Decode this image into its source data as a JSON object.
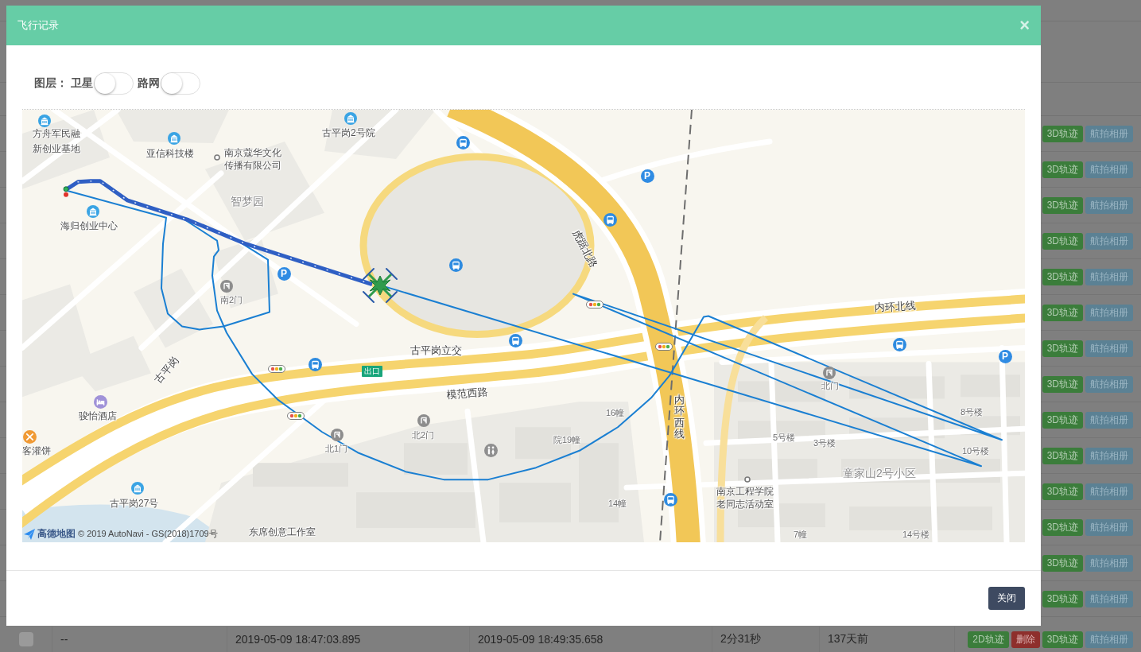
{
  "page": {
    "table": {
      "rows": [
        {
          "actions": [
            {
              "label": "3D轨迹",
              "kind": "track"
            },
            {
              "label": "航拍相册",
              "kind": "album"
            }
          ]
        },
        {
          "actions": [
            {
              "label": "3D轨迹",
              "kind": "track"
            },
            {
              "label": "航拍相册",
              "kind": "album"
            }
          ]
        },
        {
          "actions": [
            {
              "label": "3D轨迹",
              "kind": "track"
            },
            {
              "label": "航拍相册",
              "kind": "album"
            }
          ]
        },
        {
          "actions": [
            {
              "label": "3D轨迹",
              "kind": "track"
            },
            {
              "label": "航拍相册",
              "kind": "album"
            }
          ]
        },
        {
          "actions": [
            {
              "label": "3D轨迹",
              "kind": "track"
            },
            {
              "label": "航拍相册",
              "kind": "album"
            }
          ]
        },
        {
          "actions": [
            {
              "label": "3D轨迹",
              "kind": "track"
            },
            {
              "label": "航拍相册",
              "kind": "album"
            }
          ]
        },
        {
          "actions": [
            {
              "label": "3D轨迹",
              "kind": "track"
            },
            {
              "label": "航拍相册",
              "kind": "album"
            }
          ]
        },
        {
          "actions": [
            {
              "label": "3D轨迹",
              "kind": "track"
            },
            {
              "label": "航拍相册",
              "kind": "album"
            }
          ]
        },
        {
          "actions": [
            {
              "label": "3D轨迹",
              "kind": "track"
            },
            {
              "label": "航拍相册",
              "kind": "album"
            }
          ]
        },
        {
          "actions": [
            {
              "label": "3D轨迹",
              "kind": "track"
            },
            {
              "label": "航拍相册",
              "kind": "album"
            }
          ]
        },
        {
          "actions": [
            {
              "label": "3D轨迹",
              "kind": "track"
            },
            {
              "label": "航拍相册",
              "kind": "album"
            }
          ]
        },
        {
          "actions": [
            {
              "label": "3D轨迹",
              "kind": "track"
            },
            {
              "label": "航拍相册",
              "kind": "album"
            }
          ]
        },
        {
          "actions": [
            {
              "label": "3D轨迹",
              "kind": "track"
            },
            {
              "label": "航拍相册",
              "kind": "album"
            }
          ]
        },
        {
          "actions": [
            {
              "label": "3D轨迹",
              "kind": "track"
            },
            {
              "label": "航拍相册",
              "kind": "album"
            }
          ]
        },
        {
          "checked": false,
          "cells": [
            "--",
            "2019-05-09 18:47:03.895",
            "2019-05-09 18:49:35.658",
            "2分31秒",
            "137天前"
          ],
          "actions": [
            {
              "label": "2D轨迹",
              "kind": "track"
            },
            {
              "label": "删除",
              "kind": "delete"
            },
            {
              "label": "3D轨迹",
              "kind": "track"
            },
            {
              "label": "航拍相册",
              "kind": "album"
            }
          ]
        }
      ]
    }
  },
  "dialog": {
    "title": "飞行记录",
    "close": "×",
    "layers": {
      "label": "图层：",
      "toggles": [
        {
          "label": "卫星",
          "on": false
        },
        {
          "label": "路网",
          "on": false
        }
      ]
    },
    "map": {
      "labels": [
        {
          "text": "方舟军民融",
          "kind": "place"
        },
        {
          "text": "新创业基地",
          "kind": "place"
        },
        {
          "text": "亚信科技楼",
          "kind": "place"
        },
        {
          "text": "南京蔻华文化传播有限公司",
          "kind": "place"
        },
        {
          "text": "古平岗2号院",
          "kind": "place"
        },
        {
          "text": "智梦园",
          "kind": "area"
        },
        {
          "text": "海归创业中心",
          "kind": "place"
        },
        {
          "text": "南2门",
          "kind": "minor"
        },
        {
          "text": "古平岗立交",
          "kind": "road"
        },
        {
          "text": "古平岗",
          "kind": "road"
        },
        {
          "text": "模范西路",
          "kind": "road"
        },
        {
          "text": "北2门",
          "kind": "minor"
        },
        {
          "text": "北1门",
          "kind": "minor"
        },
        {
          "text": "骏怡酒店",
          "kind": "place"
        },
        {
          "text": "客灌饼",
          "kind": "place"
        },
        {
          "text": "古平岗27号",
          "kind": "place"
        },
        {
          "text": "东席创意工作室",
          "kind": "place"
        },
        {
          "text": "虎踞北路",
          "kind": "road"
        },
        {
          "text": "内环北线",
          "kind": "road"
        },
        {
          "text": "内环西线",
          "kind": "road"
        },
        {
          "text": "北门",
          "kind": "minor"
        },
        {
          "text": "16幢",
          "kind": "minor"
        },
        {
          "text": "院19幢",
          "kind": "minor"
        },
        {
          "text": "14幢",
          "kind": "minor"
        },
        {
          "text": "5号楼",
          "kind": "minor"
        },
        {
          "text": "3号楼",
          "kind": "minor"
        },
        {
          "text": "8号楼",
          "kind": "minor"
        },
        {
          "text": "10号楼",
          "kind": "minor"
        },
        {
          "text": "童家山2号小区",
          "kind": "area"
        },
        {
          "text": "南京工程学院老同志活动室",
          "kind": "place"
        },
        {
          "text": "7幢",
          "kind": "minor"
        },
        {
          "text": "14号楼",
          "kind": "minor"
        }
      ],
      "pois": [
        {
          "kind": "building"
        },
        {
          "kind": "building"
        },
        {
          "kind": "building"
        },
        {
          "kind": "building"
        },
        {
          "kind": "building"
        },
        {
          "kind": "bus"
        },
        {
          "kind": "bus"
        },
        {
          "kind": "bus"
        },
        {
          "kind": "bus"
        },
        {
          "kind": "bus"
        },
        {
          "kind": "bus"
        },
        {
          "kind": "bus"
        },
        {
          "kind": "parking",
          "glyph": "P"
        },
        {
          "kind": "parking",
          "glyph": "P"
        },
        {
          "kind": "parking",
          "glyph": "P"
        },
        {
          "kind": "traffic"
        },
        {
          "kind": "traffic"
        },
        {
          "kind": "traffic"
        },
        {
          "kind": "traffic"
        },
        {
          "kind": "gate"
        },
        {
          "kind": "gate"
        },
        {
          "kind": "gate"
        },
        {
          "kind": "gate"
        },
        {
          "kind": "toilet"
        },
        {
          "kind": "hotel"
        },
        {
          "kind": "food"
        },
        {
          "kind": "dot"
        },
        {
          "kind": "dot"
        }
      ],
      "exit_sign": "出口",
      "logo": "高德地图",
      "attribution": "© 2019 AutoNavi - GS(2018)1709号"
    },
    "buttons": [
      "关闭"
    ]
  }
}
